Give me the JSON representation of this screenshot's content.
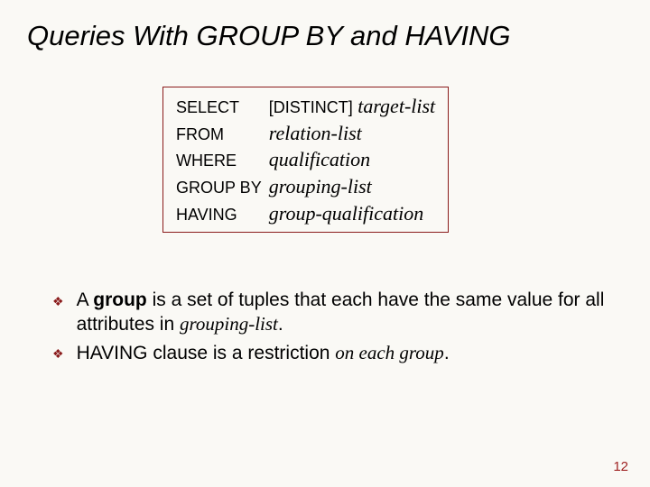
{
  "title": {
    "pre": "Queries With ",
    "kw1": "GROUP BY",
    "mid": " and ",
    "kw2": "HAVING"
  },
  "syntax": {
    "select_kw": "SELECT",
    "distinct": "[DISTINCT]",
    "target": "target-list",
    "from_kw": "FROM",
    "relation": "relation-list",
    "where_kw": "WHERE",
    "qual": "qualification",
    "group_kw": "GROUP BY",
    "grouping": "grouping-list",
    "having_kw": "HAVING",
    "groupqual": "group-qualification"
  },
  "bullets": [
    {
      "parts": [
        {
          "t": "A ",
          "cls": ""
        },
        {
          "t": "group",
          "cls": "bold"
        },
        {
          "t": " is a set of tuples that each have the same value for all attributes in ",
          "cls": ""
        },
        {
          "t": "grouping-list",
          "cls": "ital-serif"
        },
        {
          "t": ".",
          "cls": ""
        }
      ]
    },
    {
      "parts": [
        {
          "t": "HAVING clause is a restriction ",
          "cls": ""
        },
        {
          "t": "on each group",
          "cls": "ital-serif"
        },
        {
          "t": ".",
          "cls": ""
        }
      ]
    }
  ],
  "page": "12"
}
